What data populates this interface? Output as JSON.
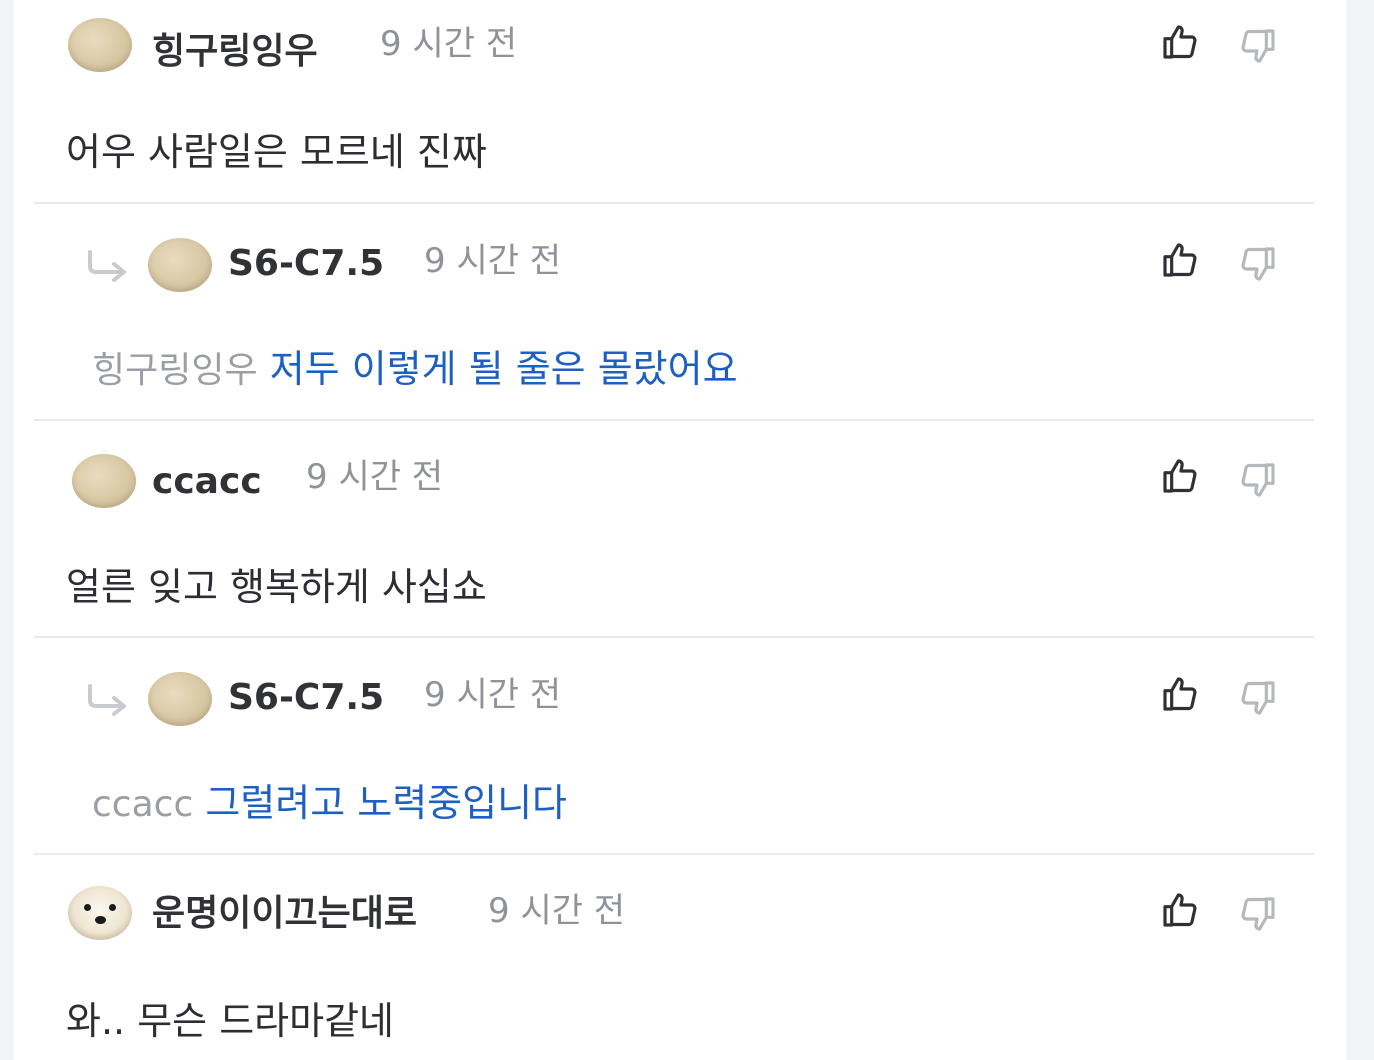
{
  "comments": [
    {
      "author": "힝구링잉우",
      "time": "9 시간 전",
      "text": "어우 사람일은 모르네 진짜",
      "reply": {
        "author": "S6-C7.5",
        "time": "9 시간 전",
        "mention": "힝구링잉우",
        "text": "저두 이렇게 될 줄은 몰랐어요"
      }
    },
    {
      "author": "ccacc",
      "time": "9 시간 전",
      "text": "얼른 잊고 행복하게 사십쇼",
      "reply": {
        "author": "S6-C7.5",
        "time": "9 시간 전",
        "mention": "ccacc",
        "text": "그럴려고 노력중입니다"
      }
    },
    {
      "author": "운명이이끄는대로",
      "time": "9 시간 전",
      "text": "와.. 무슨 드라마같네"
    }
  ],
  "icons": {
    "like": "thumbs-up-icon",
    "dislike": "thumbs-down-icon",
    "reply": "reply-arrow-icon"
  },
  "colors": {
    "name": "#303236",
    "time": "#8f9298",
    "reply_text": "#1e5fc4",
    "mention": "#9b9ea4",
    "divider": "#e9eaec"
  }
}
